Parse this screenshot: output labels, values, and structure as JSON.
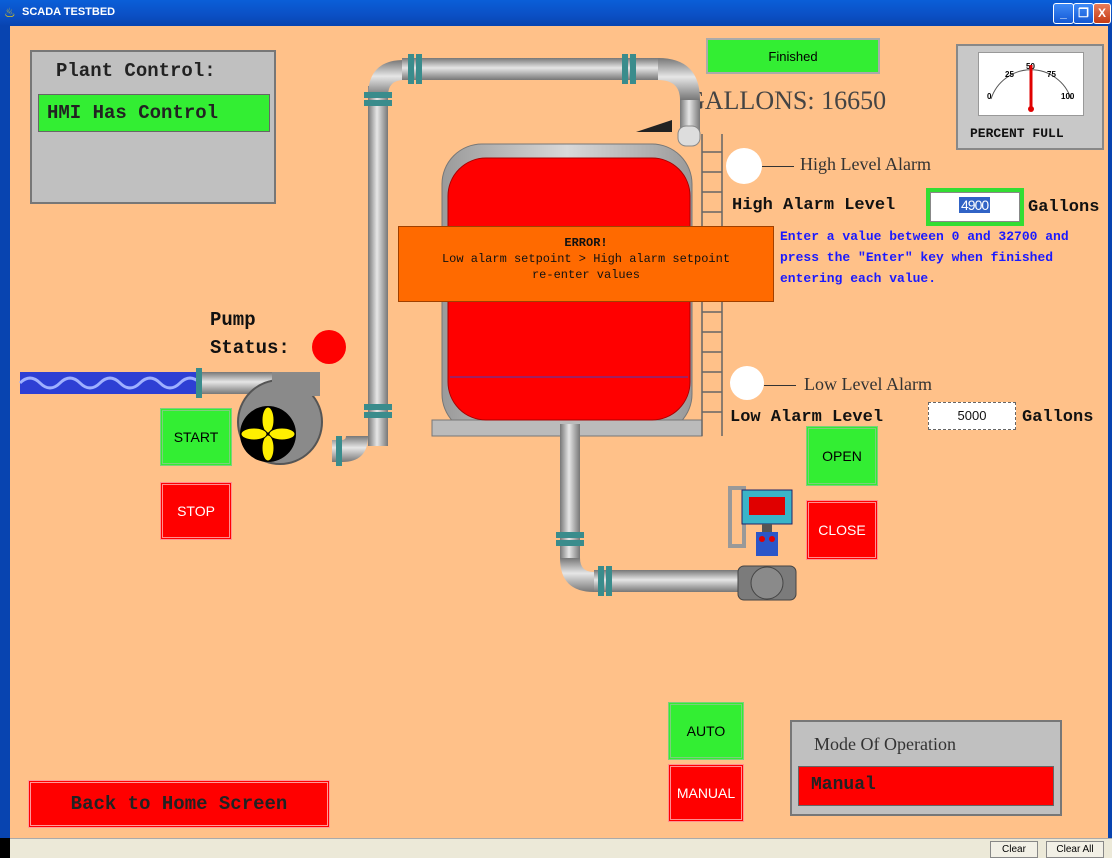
{
  "window": {
    "title": "SCADA TESTBED",
    "minimize": "_",
    "restore": "❐",
    "close": "X"
  },
  "plant_control": {
    "heading": "Plant Control:",
    "status": "HMI Has Control"
  },
  "finished_status": "Finished",
  "gallons": {
    "label": "GALLONS:",
    "value": "16650"
  },
  "gauge": {
    "label": "PERCENT FULL",
    "ticks": [
      "0",
      "25",
      "50",
      "75",
      "100"
    ],
    "level_percent": 50
  },
  "high_alarm": {
    "indicator_label": "High Level Alarm",
    "field_label": "High Alarm Level",
    "value": "4900",
    "unit": "Gallons"
  },
  "low_alarm": {
    "indicator_label": "Low Level Alarm",
    "field_label": "Low Alarm Level",
    "value": "5000",
    "unit": "Gallons"
  },
  "instructions": "Enter a value between 0 and 32700 and press the \"Enter\" key when finished entering each value.",
  "error": {
    "title": "ERROR!",
    "line1": "Low alarm setpoint > High alarm setpoint",
    "line2": "re-enter values"
  },
  "pump": {
    "label": "Pump Status:",
    "start": "START",
    "stop": "STOP"
  },
  "valve": {
    "open": "OPEN",
    "close": "CLOSE"
  },
  "mode": {
    "auto": "AUTO",
    "manual": "MANUAL",
    "title": "Mode Of Operation",
    "value": "Manual"
  },
  "home_button": "Back to Home Screen",
  "statusbar": {
    "clear": "Clear",
    "clear_all": "Clear All"
  },
  "colors": {
    "background": "#ffc189",
    "tank": "#ff0000",
    "pump_on": "#33ee33",
    "alarm_off": "#ffffff",
    "error_box": "#ff6a00",
    "instruction_text": "#1a1aff"
  }
}
